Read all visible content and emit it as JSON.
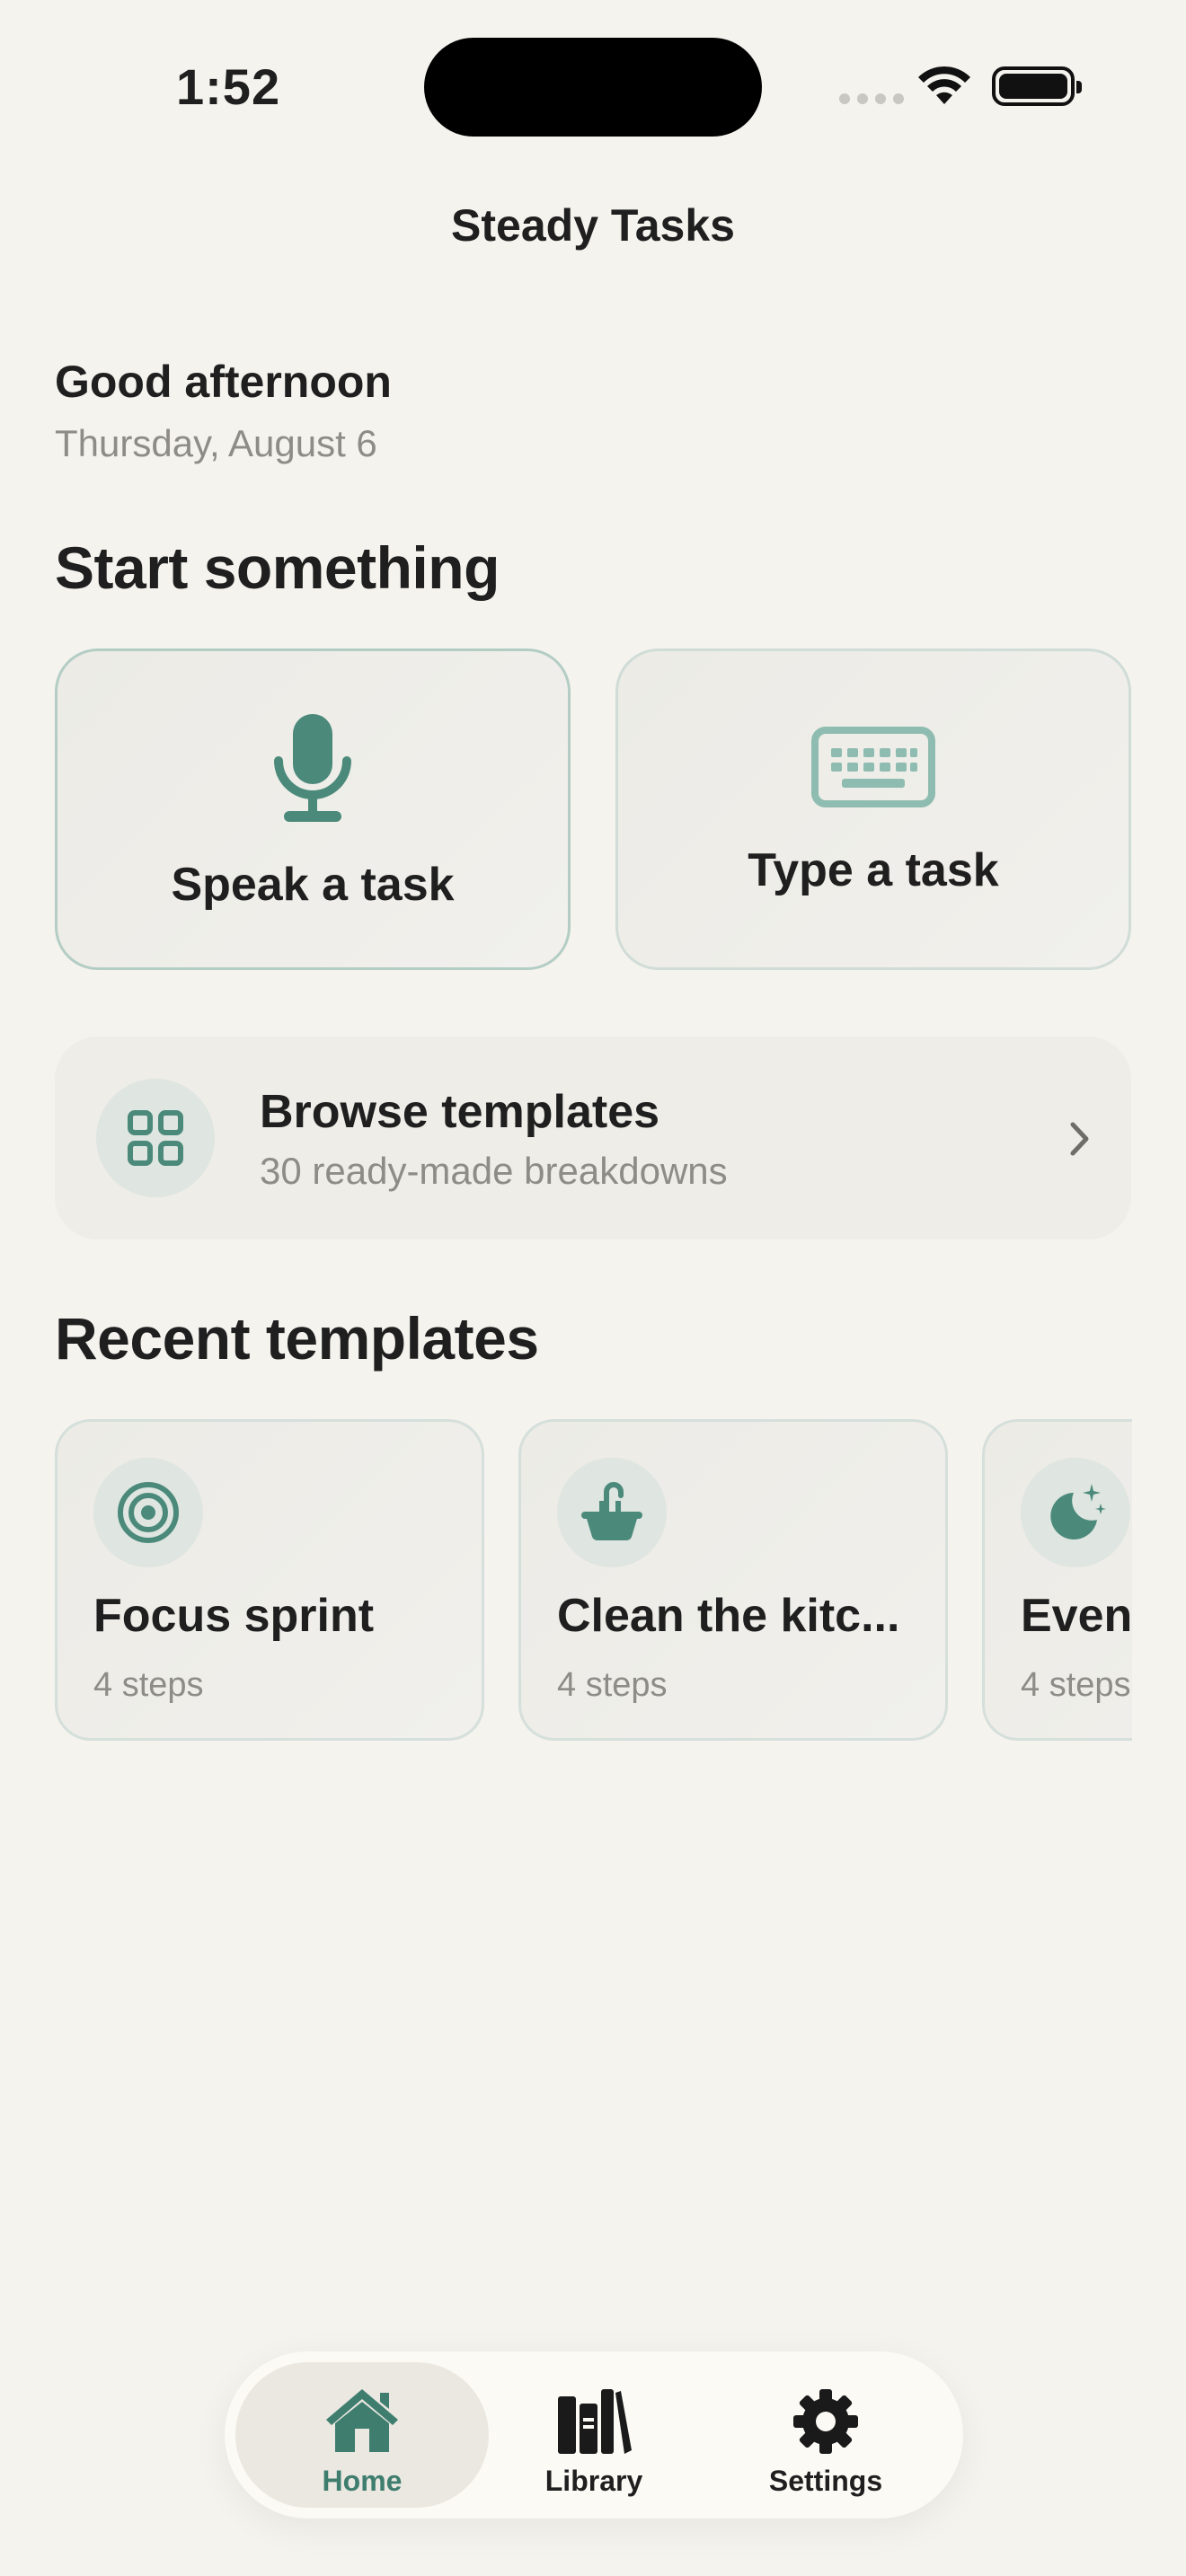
{
  "status_bar": {
    "time": "1:52"
  },
  "nav": {
    "title": "Steady Tasks"
  },
  "greeting": {
    "title": "Good afternoon",
    "date": "Thursday, August 6"
  },
  "start_section": {
    "title": "Start something",
    "speak_label": "Speak a task",
    "type_label": "Type a task"
  },
  "browse": {
    "title": "Browse templates",
    "subtitle": "30 ready-made breakdowns"
  },
  "recent": {
    "title": "Recent templates",
    "items": [
      {
        "name": "Focus sprint",
        "steps": "4 steps",
        "icon": "target-icon"
      },
      {
        "name": "Clean the kitc...",
        "steps": "4 steps",
        "icon": "sink-icon"
      },
      {
        "name": "Eveni",
        "steps": "4 steps",
        "icon": "moon-stars-icon"
      }
    ]
  },
  "tabs": [
    {
      "label": "Home",
      "icon": "house-icon",
      "active": true
    },
    {
      "label": "Library",
      "icon": "books-icon",
      "active": false
    },
    {
      "label": "Settings",
      "icon": "gear-icon",
      "active": false
    }
  ],
  "colors": {
    "accent": "#4b8a7b",
    "background": "#f5f3ee",
    "card": "#eeede8"
  }
}
